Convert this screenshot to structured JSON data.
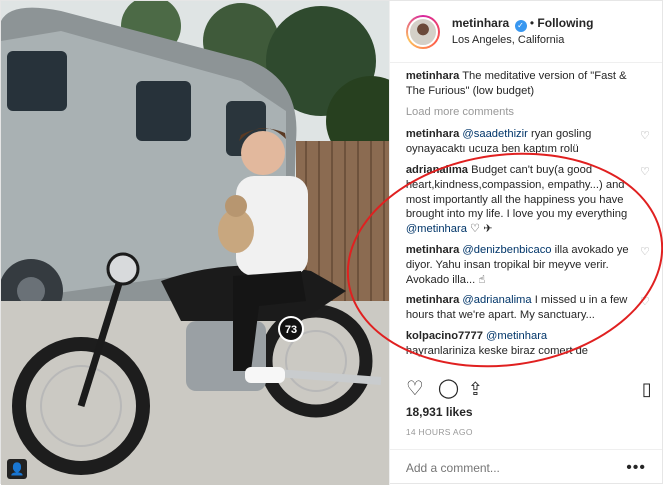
{
  "header": {
    "username": "metinhara",
    "follow_label": "Following",
    "separator": "•",
    "location": "Los Angeles, California"
  },
  "caption": {
    "username": "metinhara",
    "text": "The meditative version of \"Fast & The Furious\" (low budget)"
  },
  "load_more_label": "Load more comments",
  "comments": [
    {
      "username": "metinhara",
      "mention": "@saadethizir",
      "text": " ryan gosling oynayacaktı ucuza ben kaptım rolü"
    },
    {
      "username": "adrianalima",
      "mention": "",
      "text": "Budget can't buy(a good heart,kindness,compassion, empathy...) and most importantly all the happiness you have brought into my life. I love you my everything",
      "mention_after": "@metinhara",
      "tail": " ♡ ✈"
    },
    {
      "username": "metinhara",
      "mention": "@denizbenbicaco",
      "text": " illa avokado ye diyor. Yahu insan tropikal bir meyve verir. Avokado illa... ☝"
    },
    {
      "username": "metinhara",
      "mention": "@adrianalima",
      "text": " I missed u in a few hours that we're apart. My sanctuary..."
    },
    {
      "username": "kolpacino7777",
      "mention": "@metinhara",
      "text": "hayranlariniza keske biraz comert de"
    }
  ],
  "likes": "18,931 likes",
  "timestamp": "14 HOURS AGO",
  "add_comment": {
    "placeholder": "Add a comment..."
  },
  "more_label": "•••",
  "icons": [
    "heart-icon",
    "comment-icon",
    "share-icon",
    "bookmark-icon",
    "more-options-icon",
    "tagged-user-icon"
  ],
  "colors": {
    "verified": "#3897f0",
    "mention": "#003569",
    "annotation": "#e02020"
  }
}
